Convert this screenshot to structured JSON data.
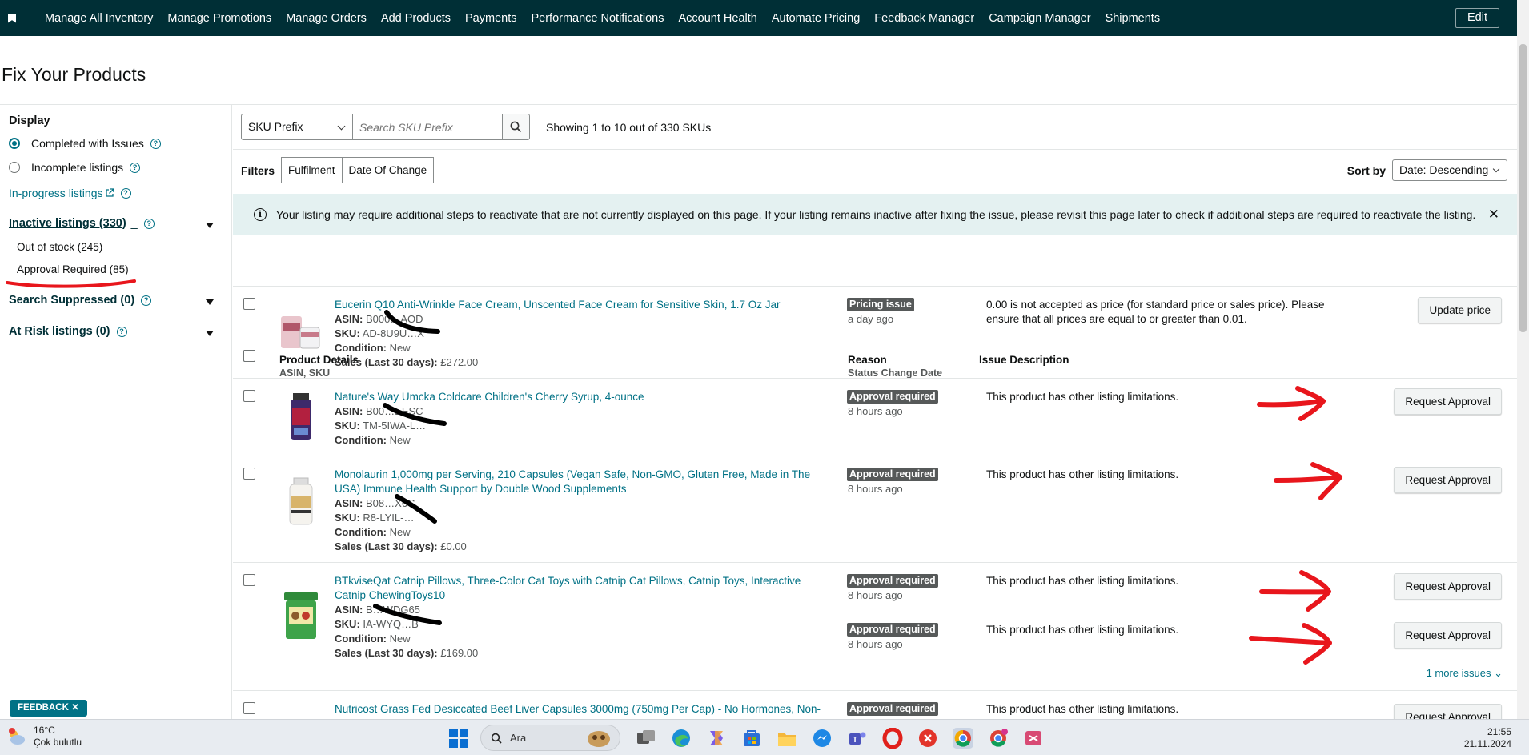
{
  "nav": {
    "items": [
      "Manage All Inventory",
      "Manage Promotions",
      "Manage Orders",
      "Add Products",
      "Payments",
      "Performance Notifications",
      "Account Health",
      "Automate Pricing",
      "Feedback Manager",
      "Campaign Manager",
      "Shipments"
    ],
    "edit": "Edit"
  },
  "page": {
    "title": "Fix Your Products"
  },
  "sidebar": {
    "display_label": "Display",
    "opt_completed": "Completed with Issues",
    "opt_incomplete": "Incomplete listings",
    "in_progress": "In-progress listings",
    "inactive": "Inactive listings (330)",
    "inactive_suffix": "_",
    "out_of_stock": "Out of stock (245)",
    "approval_required": "Approval Required (85)",
    "search_suppressed": "Search Suppressed (0)",
    "at_risk": "At Risk listings (0)",
    "feedback": "FEEDBACK ✕"
  },
  "toolbar": {
    "sku_select": "SKU Prefix",
    "search_placeholder": "Search SKU Prefix",
    "showing": "Showing 1 to 10 out of 330 SKUs",
    "filters_label": "Filters",
    "filter_fulfilment": "Fulfilment",
    "filter_date": "Date Of Change",
    "sort_label": "Sort by",
    "sort_value": "Date: Descending"
  },
  "banner": {
    "text": "Your listing may require additional steps to reactivate that are not currently displayed on this page. If your listing remains inactive after fixing the issue, please revisit this page later to check if additional steps are required to reactivate the listing.",
    "close": "✕"
  },
  "table": {
    "col_product": "Product Details",
    "col_product_sub": "ASIN, SKU",
    "col_reason": "Reason",
    "col_reason_sub": "Status Change Date",
    "col_issue": "Issue Description",
    "rows": [
      {
        "title": "Eucerin Q10 Anti-Wrinkle Face Cream, Unscented Face Cream for Sensitive Skin, 1.7 Oz Jar",
        "asin_label": "ASIN:",
        "asin": "B000…AOD",
        "sku_label": "SKU:",
        "sku": "AD-8U9U…X",
        "cond_label": "Condition:",
        "cond": "New",
        "sales_label": "Sales  (Last 30 days):",
        "sales": "£272.00",
        "reason": "Pricing issue",
        "ago": "a day ago",
        "issue": "0.00 is not accepted as price (for standard price or sales price). Please ensure that all prices are equal to or greater than 0.01.",
        "action": "Update price"
      },
      {
        "title": "Nature's Way Umcka Coldcare Children's Cherry Syrup, 4-ounce",
        "asin_label": "ASIN:",
        "asin": "B00…EESC",
        "sku_label": "SKU:",
        "sku": "TM-5IWA-L…",
        "cond_label": "Condition:",
        "cond": "New",
        "reason": "Approval required",
        "ago": "8 hours ago",
        "issue": "This product has other listing limitations.",
        "action": "Request Approval"
      },
      {
        "title": "Monolaurin 1,000mg per Serving, 210 Capsules (Vegan Safe, Non-GMO, Gluten Free, Made in The USA) Immune Health Support by Double Wood Supplements",
        "asin_label": "ASIN:",
        "asin": "B08…X6C",
        "sku_label": "SKU:",
        "sku": "R8-LYIL-…",
        "cond_label": "Condition:",
        "cond": "New",
        "sales_label": "Sales  (Last 30 days):",
        "sales": "£0.00",
        "reason": "Approval required",
        "ago": "8 hours ago",
        "issue": "This product has other listing limitations.",
        "action": "Request Approval"
      },
      {
        "title": "BTkviseQat Catnip Pillows, Three-Color Cat Toys with Catnip Cat Pillows, Catnip Toys, Interactive Catnip ChewingToys10",
        "asin_label": "ASIN:",
        "asin": "B…WDG65",
        "sku_label": "SKU:",
        "sku": "IA-WYQ…B",
        "cond_label": "Condition:",
        "cond": "New",
        "sales_label": "Sales  (Last 30 days):",
        "sales": "£169.00",
        "reason": "Approval required",
        "ago": "8 hours ago",
        "issue": "This product has other listing limitations.",
        "action": "Request Approval",
        "reason2": "Approval required",
        "ago2": "8 hours ago",
        "issue2": "This product has other listing limitations.",
        "action2": "Request Approval",
        "more": "1 more issues ⌄"
      },
      {
        "title": "Nutricost Grass Fed Desiccated Beef Liver Capsules 3000mg (750mg Per Cap) - No Hormones, Non-",
        "reason": "Approval required",
        "issue": "This product has other listing limitations.",
        "action": "Request Approval"
      }
    ]
  },
  "taskbar": {
    "temp": "16°C",
    "weather": "Çok bulutlu",
    "search": "Ara",
    "time": "21:55",
    "date": "21.11.2024"
  },
  "colors": {
    "nav_bg": "#002f36",
    "link": "#007185",
    "banner_bg": "#e4f1f1",
    "badge": "#565959",
    "annotation": "#e8161c"
  }
}
